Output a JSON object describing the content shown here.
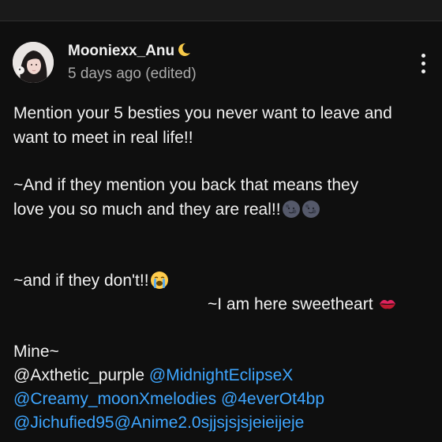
{
  "header": {
    "partial_title": ""
  },
  "comment": {
    "author": "Mooniexx_Anu",
    "author_emoji": "crescent-moon-emoji",
    "timestamp": "5 days ago (edited)",
    "menu_icon": "more-vertical-icon",
    "lines": {
      "l1": "Mention your 5 besties you never want to leave and",
      "l2": "want to meet in real life!!",
      "l3": "~And if they mention you back that means they",
      "l4": "love you so much and they are real!!",
      "l5": "~and if they don't!!",
      "l6": "~I am here sweetheart",
      "l7": "Mine~"
    },
    "mentions": {
      "m1": "@Axthetic_purple",
      "m2": "@MidnightEclipseX",
      "m3": "@Creamy_moonXmelodies",
      "m4": "@4everOt4bp",
      "m5": "@Jichufied95",
      "m6": "@Anime2.0sjjsjsjsjeieijeje"
    },
    "emojis": {
      "new_moon_face": "new-moon-face-emoji",
      "crying": "loudly-crying-face-emoji",
      "kiss": "kiss-mark-emoji"
    },
    "colors": {
      "background": "#0f0f0f",
      "text": "#f1f1f1",
      "secondary_text": "#aaaaaa",
      "link": "#3ea6ff"
    }
  }
}
